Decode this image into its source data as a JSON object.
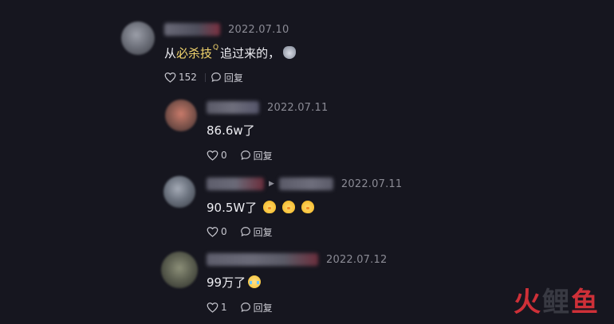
{
  "comments": [
    {
      "date": "2022.07.10",
      "text_before": "从",
      "keyword": "必杀技",
      "search_symbol": "Q",
      "text_after": "追过来的，",
      "emoji": "cat-face",
      "likes": "152",
      "reply_label": "回复"
    },
    {
      "date": "2022.07.11",
      "text": "86.6w了",
      "likes": "0",
      "reply_label": "回复"
    },
    {
      "date": "2022.07.11",
      "text": "90.5W了",
      "emojis": [
        "chick",
        "chick",
        "chick"
      ],
      "likes": "0",
      "reply_label": "回复"
    },
    {
      "date": "2022.07.12",
      "text": "99万了",
      "emojis": [
        "crying-face"
      ],
      "likes": "1",
      "reply_label": "回复"
    }
  ],
  "watermark": {
    "char1": "火",
    "char2": "鲤",
    "char3": "鱼",
    "color_primary": "#d8323a",
    "color_secondary": "#3a3b44"
  },
  "colors": {
    "background": "#16161f",
    "keyword": "#f5d76e",
    "secondary_text": "#8b8b95"
  }
}
